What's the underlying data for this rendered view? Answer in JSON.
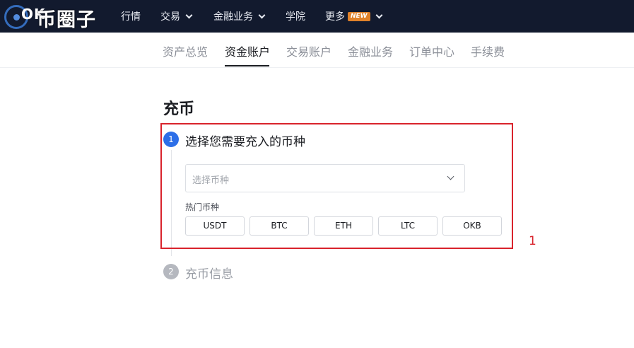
{
  "topbar": {
    "logo_text": "OK",
    "watermark": "币圈子",
    "nav": [
      {
        "label": "行情",
        "has_chevron": false
      },
      {
        "label": "交易",
        "has_chevron": true
      },
      {
        "label": "金融业务",
        "has_chevron": true
      },
      {
        "label": "学院",
        "has_chevron": false
      },
      {
        "label": "更多",
        "has_chevron": true,
        "badge": "NEW"
      }
    ]
  },
  "subnav": {
    "tabs": [
      {
        "label": "资产总览",
        "active": false
      },
      {
        "label": "资金账户",
        "active": true
      },
      {
        "label": "交易账户",
        "active": false
      },
      {
        "label": "金融业务",
        "active": false
      },
      {
        "label": "订单中心",
        "active": false
      },
      {
        "label": "手续费",
        "active": false
      }
    ]
  },
  "page": {
    "title": "充币",
    "step1": {
      "number": "1",
      "title": "选择您需要充入的币种"
    },
    "select": {
      "placeholder": "选择币种",
      "icon": "chevron-down-icon"
    },
    "hot_label": "热门币种",
    "coins": [
      "USDT",
      "BTC",
      "ETH",
      "LTC",
      "OKB"
    ],
    "step2": {
      "number": "2",
      "title": "充币信息"
    }
  },
  "annotation": {
    "label": "1",
    "color": "#d9232c"
  },
  "colors": {
    "topbar": "#121a2e",
    "accent": "#2d6fe8",
    "inactive_step": "#b5b8bf"
  }
}
